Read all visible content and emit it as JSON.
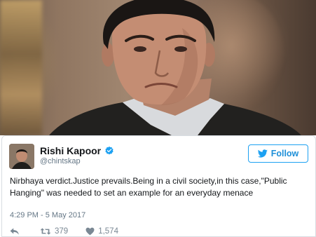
{
  "tweet": {
    "author_name": "Rishi Kapoor",
    "handle": "@chintskap",
    "follow_label": "Follow",
    "text": "Nirbhaya verdict.Justice prevails.Being in a civil society,in this case,\"Public Hanging\" was needed to set an example for an everyday menace",
    "timestamp": "4:29 PM - 5 May 2017",
    "retweet_count": "379",
    "like_count": "1,574"
  },
  "colors": {
    "twitter_blue": "#1da1f2",
    "text_primary": "#14171a",
    "text_secondary": "#657786"
  },
  "icons": {
    "verified": "verified-badge-icon",
    "follow": "twitter-bird-icon",
    "reply": "reply-icon",
    "retweet": "retweet-icon",
    "like": "heart-icon"
  }
}
